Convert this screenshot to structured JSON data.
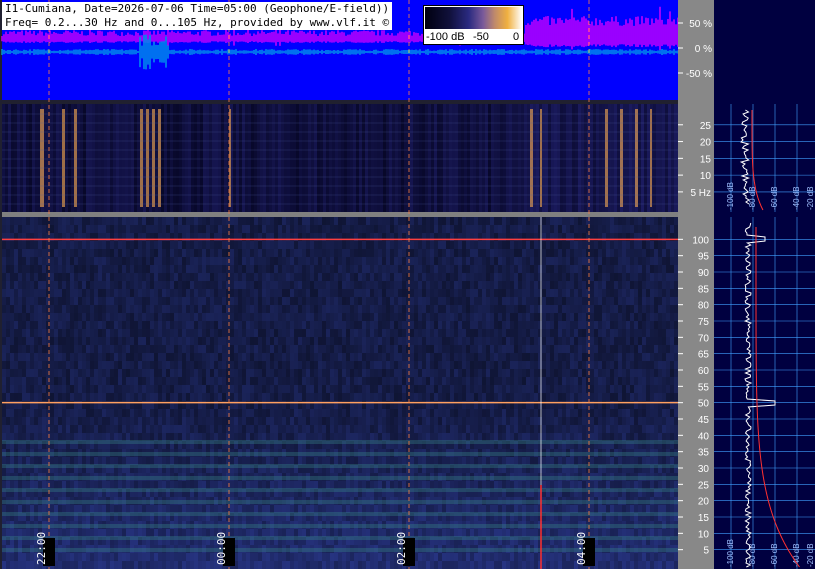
{
  "header": {
    "line1": "I1-Cumiana, Date=2026-07-06 Time=05:00 (Geophone/E-field))",
    "line2": "Freq= 0.2...30 Hz and 0...105 Hz, provided by www.vlf.it ©"
  },
  "colorbar": {
    "labels": [
      "-100 dB",
      "-50",
      "0"
    ]
  },
  "colors": {
    "trace_panel_bg": "#0000ff",
    "trace_magenta": "#ff00ff",
    "trace_cyan": "#00e0e0",
    "spectro_bg": "#2a2a70",
    "grid_cyan": "#40a0ff",
    "time_marker": "#ff8040",
    "mains_line": "#ff4040",
    "side_bg": "#000040",
    "axis_bg": "#808080"
  },
  "chart_data": [
    {
      "type": "line",
      "panel": "amplitude",
      "y_ticks": [
        "50 %",
        "0 %",
        "-50 %"
      ],
      "y_values": [
        50,
        0,
        -50
      ],
      "ylim": [
        -100,
        100
      ]
    },
    {
      "type": "heatmap",
      "panel": "low-frequency spectrogram",
      "y_unit_label": "Hz",
      "y_ticks": [
        "25",
        "20",
        "15",
        "10",
        "5 Hz"
      ],
      "y_values": [
        25,
        20,
        15,
        10,
        5
      ],
      "ylim": [
        0.2,
        30
      ]
    },
    {
      "type": "heatmap",
      "panel": "high-frequency spectrogram",
      "y_ticks": [
        "100",
        "95",
        "90",
        "85",
        "80",
        "75",
        "70",
        "65",
        "60",
        "55",
        "50",
        "45",
        "40",
        "35",
        "30",
        "25",
        "20",
        "15",
        "10",
        "5"
      ],
      "y_values": [
        100,
        95,
        90,
        85,
        80,
        75,
        70,
        65,
        60,
        55,
        50,
        45,
        40,
        35,
        30,
        25,
        20,
        15,
        10,
        5
      ],
      "ylim": [
        0,
        105
      ],
      "highlight_lines_hz": [
        50,
        100
      ]
    },
    {
      "type": "line",
      "panel": "x-axis time",
      "x_ticks": [
        "22:00",
        "00:00",
        "02:00",
        "04:00"
      ]
    },
    {
      "type": "line",
      "panel": "side spectrum",
      "x_ticks_top": [
        "-100 dB",
        "-80 dB",
        "-60 dB",
        "-40 dB",
        "-20 dB"
      ],
      "x_ticks_bottom": [
        "-100 dB",
        "-80 dB",
        "-60 dB",
        "-40 dB",
        "-20 dB"
      ]
    }
  ]
}
